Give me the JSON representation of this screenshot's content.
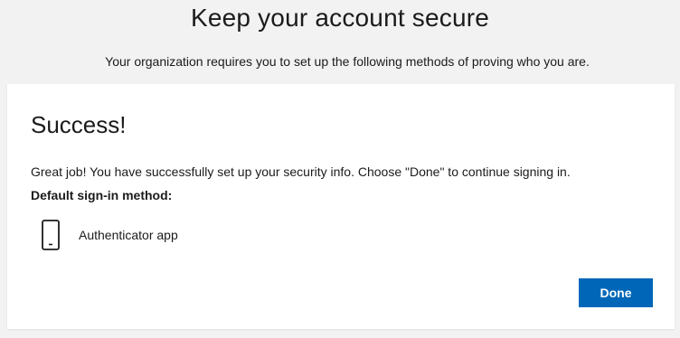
{
  "header": {
    "title": "Keep your account secure",
    "subtitle": "Your organization requires you to set up the following methods of proving who you are."
  },
  "card": {
    "title": "Success!",
    "message": "Great job! You have successfully set up your security info. Choose \"Done\" to continue signing in.",
    "default_method_label": "Default sign-in method:",
    "method": {
      "icon": "phone-icon",
      "label": "Authenticator app"
    },
    "done_label": "Done"
  },
  "colors": {
    "background": "#f2f2f2",
    "card": "#ffffff",
    "accent": "#0067b8",
    "text": "#1b1b1b"
  }
}
